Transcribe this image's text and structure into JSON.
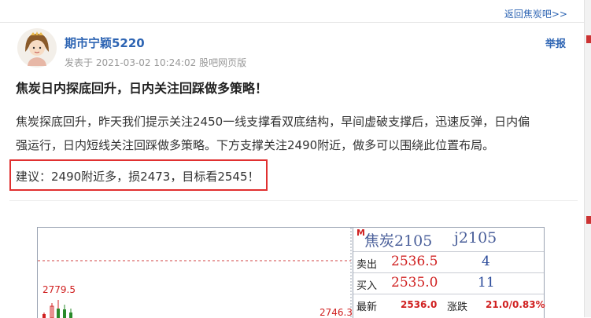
{
  "nav": {
    "back_label": "返回焦炭吧>>"
  },
  "post": {
    "author": "期市宁颖5220",
    "meta": "发表于 2021-03-02 10:24:02 股吧网页版",
    "report_label": "举报",
    "title": "焦炭日内探底回升，日内关注回踩做多策略！",
    "body_line1": "焦炭探底回升，昨天我们提示关注2450一线支撑看双底结构，早间虚破支撑后，迅速反弹，日内偏",
    "body_line2": "强运行，日内短线关注回踩做多策略。下方支撑关注2490附近，做多可以围绕此位置布局。",
    "suggestion": "建议：2490附近多，损2473，目标看2545！"
  },
  "chart": {
    "high_label": "2779.5",
    "right_label": "2746.3",
    "badge": "M",
    "name": "焦炭2105",
    "code": "j2105",
    "sell_label": "卖出",
    "sell_price": "2536.5",
    "sell_vol": "4",
    "buy_label": "买入",
    "buy_price": "2535.0",
    "buy_vol": "11",
    "last_label": "最新",
    "last_price": "2536.0",
    "change_label": "涨跌",
    "change_value": "21.0/0.83%"
  },
  "colors": {
    "link_blue": "#2d64b3",
    "highlight_red": "#e03030",
    "price_red": "#d02020",
    "volume_blue": "#2a4a9a"
  }
}
